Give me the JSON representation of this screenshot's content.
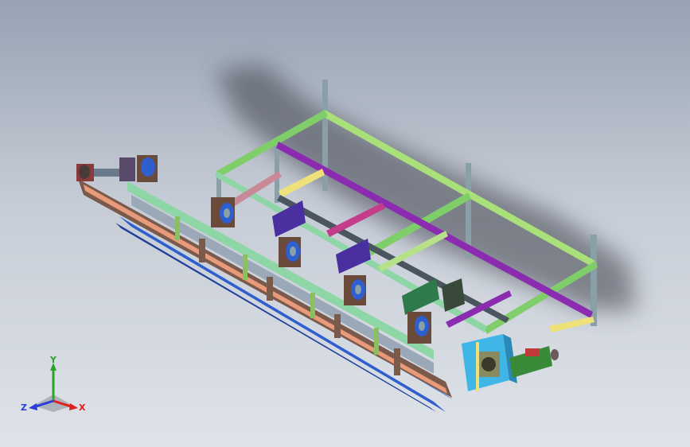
{
  "view": {
    "background_top": "#97a2b3",
    "background_bottom": "#dfe3e9"
  },
  "triad": {
    "x_label": "X",
    "y_label": "Y",
    "z_label": "Z",
    "x_color": "#e0201c",
    "y_color": "#2aa52a",
    "z_color": "#2a3fd8"
  },
  "model": {
    "frame_colors": {
      "green": "#a9e07a",
      "light_green": "#8fd6a6",
      "purple": "#8a2bb0",
      "blue": "#2f5fcf",
      "steel": "#8aa0a8",
      "brown": "#7a5a4a",
      "yellow": "#efe17a",
      "pink": "#c98a98",
      "cyan": "#3fb6e6"
    }
  }
}
